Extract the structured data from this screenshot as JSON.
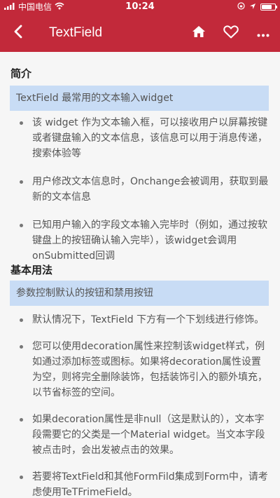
{
  "status_bar": {
    "carrier": "中国电信",
    "time": "10:24"
  },
  "nav": {
    "title": "TextField"
  },
  "sections": [
    {
      "title": "简介",
      "highlight": "TextField 最常用的文本输入widget",
      "bullets": [
        "该 widget 作为文本输入框，可以接收用户以屏幕按键或者键盘输入的文本信息，该信息可以用于消息传递，搜索体验等",
        "用户修改文本信息时，Onchange会被调用，获取到最新的文本信息",
        "已知用户输入的字段文本输入完毕时（例如，通过按软键盘上的按钮确认输入完毕），该widget会调用onSubmitted回调"
      ]
    },
    {
      "title": "基本用法",
      "highlight": "参数控制默认的按钮和禁用按钮",
      "bullets": [
        "默认情况下，TextField 下方有一个下划线进行修饰。",
        "您可以使用decoration属性来控制该widget样式，例如通过添加标签或图标。如果将decoration属性设置为空，则将完全删除装饰，包括装饰引入的额外填充，以节省标签的空间。",
        "如果decoration属性是非null（这是默认的），文本字段需要它的父类是一个Material widget。当文本字段被点击时，会出发被点击的效果。",
        "若要将TextField和其他FormFild集成到Form中，请考虑使用TeTFrimeField。"
      ]
    }
  ],
  "colors": {
    "header": "#c2293a",
    "highlight": "#c8dcf5",
    "background": "#f6f6f6"
  }
}
